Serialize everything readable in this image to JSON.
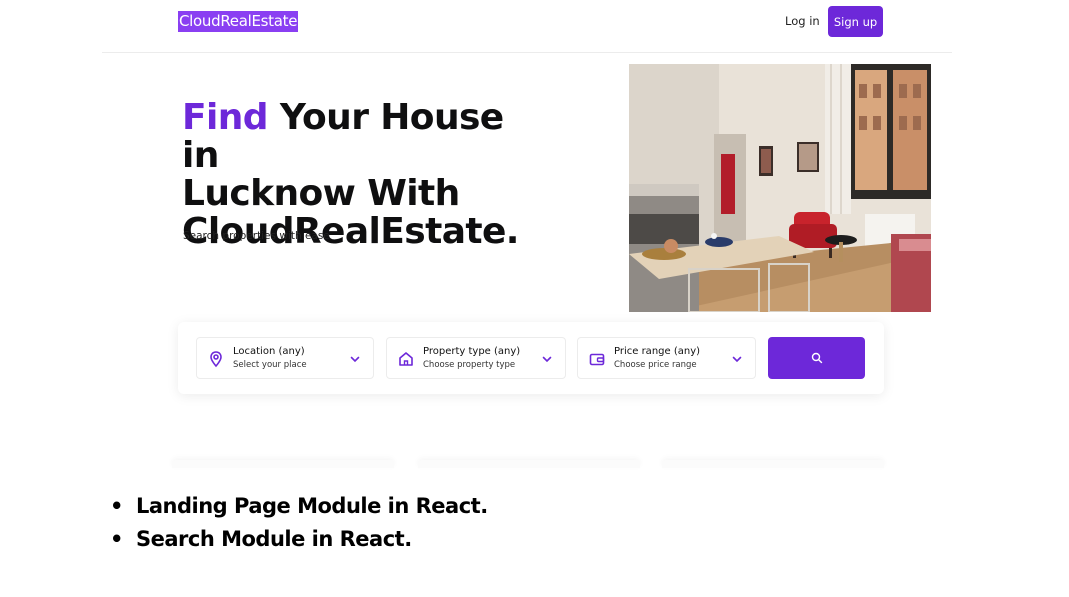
{
  "header": {
    "logo_text": "CloudRealEstate",
    "login_label": "Log in",
    "signup_label": "Sign up"
  },
  "hero": {
    "title_accent": "Find",
    "title_rest_line1": " Your House in",
    "title_line2": "Lucknow With",
    "title_line3": "CloudRealEstate.",
    "subtitle": "Search properties with ease"
  },
  "search": {
    "filters": [
      {
        "title": "Location (any)",
        "subtitle": "Select your place",
        "icon": "map-pin-icon"
      },
      {
        "title": "Property type (any)",
        "subtitle": "Choose property type",
        "icon": "home-icon"
      },
      {
        "title": "Price range (any)",
        "subtitle": "Choose price range",
        "icon": "wallet-icon"
      }
    ],
    "button_icon": "search-icon"
  },
  "slide_notes": {
    "bullets": [
      "Landing Page Module in React.",
      "Search Module in React."
    ]
  },
  "colors": {
    "accent": "#6d28d9",
    "logo_highlight": "#8a3ff2"
  }
}
